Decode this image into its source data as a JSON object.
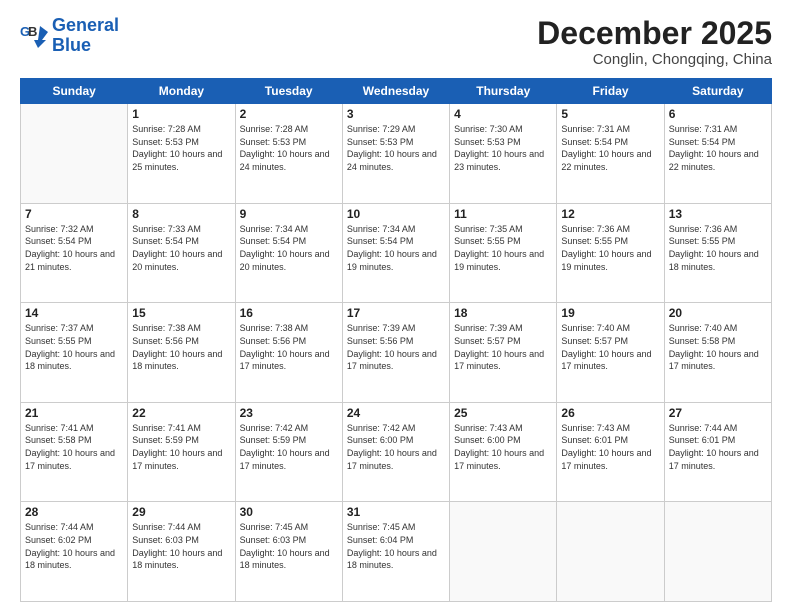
{
  "logo": {
    "line1": "General",
    "line2": "Blue"
  },
  "header": {
    "month": "December 2025",
    "location": "Conglin, Chongqing, China"
  },
  "days_of_week": [
    "Sunday",
    "Monday",
    "Tuesday",
    "Wednesday",
    "Thursday",
    "Friday",
    "Saturday"
  ],
  "weeks": [
    [
      {
        "day": "",
        "sunrise": "",
        "sunset": "",
        "daylight": ""
      },
      {
        "day": "1",
        "sunrise": "Sunrise: 7:28 AM",
        "sunset": "Sunset: 5:53 PM",
        "daylight": "Daylight: 10 hours and 25 minutes."
      },
      {
        "day": "2",
        "sunrise": "Sunrise: 7:28 AM",
        "sunset": "Sunset: 5:53 PM",
        "daylight": "Daylight: 10 hours and 24 minutes."
      },
      {
        "day": "3",
        "sunrise": "Sunrise: 7:29 AM",
        "sunset": "Sunset: 5:53 PM",
        "daylight": "Daylight: 10 hours and 24 minutes."
      },
      {
        "day": "4",
        "sunrise": "Sunrise: 7:30 AM",
        "sunset": "Sunset: 5:53 PM",
        "daylight": "Daylight: 10 hours and 23 minutes."
      },
      {
        "day": "5",
        "sunrise": "Sunrise: 7:31 AM",
        "sunset": "Sunset: 5:54 PM",
        "daylight": "Daylight: 10 hours and 22 minutes."
      },
      {
        "day": "6",
        "sunrise": "Sunrise: 7:31 AM",
        "sunset": "Sunset: 5:54 PM",
        "daylight": "Daylight: 10 hours and 22 minutes."
      }
    ],
    [
      {
        "day": "7",
        "sunrise": "Sunrise: 7:32 AM",
        "sunset": "Sunset: 5:54 PM",
        "daylight": "Daylight: 10 hours and 21 minutes."
      },
      {
        "day": "8",
        "sunrise": "Sunrise: 7:33 AM",
        "sunset": "Sunset: 5:54 PM",
        "daylight": "Daylight: 10 hours and 20 minutes."
      },
      {
        "day": "9",
        "sunrise": "Sunrise: 7:34 AM",
        "sunset": "Sunset: 5:54 PM",
        "daylight": "Daylight: 10 hours and 20 minutes."
      },
      {
        "day": "10",
        "sunrise": "Sunrise: 7:34 AM",
        "sunset": "Sunset: 5:54 PM",
        "daylight": "Daylight: 10 hours and 19 minutes."
      },
      {
        "day": "11",
        "sunrise": "Sunrise: 7:35 AM",
        "sunset": "Sunset: 5:55 PM",
        "daylight": "Daylight: 10 hours and 19 minutes."
      },
      {
        "day": "12",
        "sunrise": "Sunrise: 7:36 AM",
        "sunset": "Sunset: 5:55 PM",
        "daylight": "Daylight: 10 hours and 19 minutes."
      },
      {
        "day": "13",
        "sunrise": "Sunrise: 7:36 AM",
        "sunset": "Sunset: 5:55 PM",
        "daylight": "Daylight: 10 hours and 18 minutes."
      }
    ],
    [
      {
        "day": "14",
        "sunrise": "Sunrise: 7:37 AM",
        "sunset": "Sunset: 5:55 PM",
        "daylight": "Daylight: 10 hours and 18 minutes."
      },
      {
        "day": "15",
        "sunrise": "Sunrise: 7:38 AM",
        "sunset": "Sunset: 5:56 PM",
        "daylight": "Daylight: 10 hours and 18 minutes."
      },
      {
        "day": "16",
        "sunrise": "Sunrise: 7:38 AM",
        "sunset": "Sunset: 5:56 PM",
        "daylight": "Daylight: 10 hours and 17 minutes."
      },
      {
        "day": "17",
        "sunrise": "Sunrise: 7:39 AM",
        "sunset": "Sunset: 5:56 PM",
        "daylight": "Daylight: 10 hours and 17 minutes."
      },
      {
        "day": "18",
        "sunrise": "Sunrise: 7:39 AM",
        "sunset": "Sunset: 5:57 PM",
        "daylight": "Daylight: 10 hours and 17 minutes."
      },
      {
        "day": "19",
        "sunrise": "Sunrise: 7:40 AM",
        "sunset": "Sunset: 5:57 PM",
        "daylight": "Daylight: 10 hours and 17 minutes."
      },
      {
        "day": "20",
        "sunrise": "Sunrise: 7:40 AM",
        "sunset": "Sunset: 5:58 PM",
        "daylight": "Daylight: 10 hours and 17 minutes."
      }
    ],
    [
      {
        "day": "21",
        "sunrise": "Sunrise: 7:41 AM",
        "sunset": "Sunset: 5:58 PM",
        "daylight": "Daylight: 10 hours and 17 minutes."
      },
      {
        "day": "22",
        "sunrise": "Sunrise: 7:41 AM",
        "sunset": "Sunset: 5:59 PM",
        "daylight": "Daylight: 10 hours and 17 minutes."
      },
      {
        "day": "23",
        "sunrise": "Sunrise: 7:42 AM",
        "sunset": "Sunset: 5:59 PM",
        "daylight": "Daylight: 10 hours and 17 minutes."
      },
      {
        "day": "24",
        "sunrise": "Sunrise: 7:42 AM",
        "sunset": "Sunset: 6:00 PM",
        "daylight": "Daylight: 10 hours and 17 minutes."
      },
      {
        "day": "25",
        "sunrise": "Sunrise: 7:43 AM",
        "sunset": "Sunset: 6:00 PM",
        "daylight": "Daylight: 10 hours and 17 minutes."
      },
      {
        "day": "26",
        "sunrise": "Sunrise: 7:43 AM",
        "sunset": "Sunset: 6:01 PM",
        "daylight": "Daylight: 10 hours and 17 minutes."
      },
      {
        "day": "27",
        "sunrise": "Sunrise: 7:44 AM",
        "sunset": "Sunset: 6:01 PM",
        "daylight": "Daylight: 10 hours and 17 minutes."
      }
    ],
    [
      {
        "day": "28",
        "sunrise": "Sunrise: 7:44 AM",
        "sunset": "Sunset: 6:02 PM",
        "daylight": "Daylight: 10 hours and 18 minutes."
      },
      {
        "day": "29",
        "sunrise": "Sunrise: 7:44 AM",
        "sunset": "Sunset: 6:03 PM",
        "daylight": "Daylight: 10 hours and 18 minutes."
      },
      {
        "day": "30",
        "sunrise": "Sunrise: 7:45 AM",
        "sunset": "Sunset: 6:03 PM",
        "daylight": "Daylight: 10 hours and 18 minutes."
      },
      {
        "day": "31",
        "sunrise": "Sunrise: 7:45 AM",
        "sunset": "Sunset: 6:04 PM",
        "daylight": "Daylight: 10 hours and 18 minutes."
      },
      {
        "day": "",
        "sunrise": "",
        "sunset": "",
        "daylight": ""
      },
      {
        "day": "",
        "sunrise": "",
        "sunset": "",
        "daylight": ""
      },
      {
        "day": "",
        "sunrise": "",
        "sunset": "",
        "daylight": ""
      }
    ]
  ]
}
